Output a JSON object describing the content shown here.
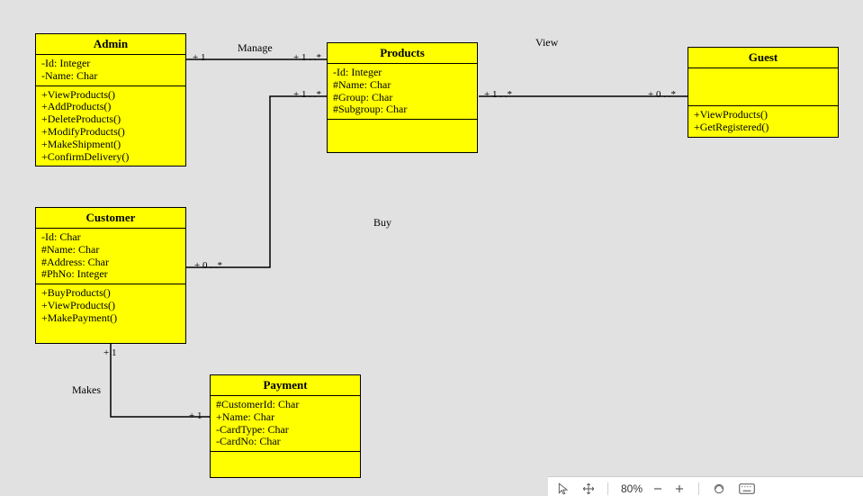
{
  "classes": {
    "admin": {
      "title": "Admin",
      "attrs": [
        "-Id: Integer",
        "-Name: Char"
      ],
      "ops": [
        "+ViewProducts()",
        "+AddProducts()",
        "+DeleteProducts()",
        "+ModifyProducts()",
        "+MakeShipment()",
        "+ConfirmDelivery()"
      ]
    },
    "products": {
      "title": "Products",
      "attrs": [
        "-Id: Integer",
        "#Name: Char",
        "#Group: Char",
        "#Subgroup: Char"
      ],
      "ops": []
    },
    "guest": {
      "title": "Guest",
      "attrs": [],
      "ops": [
        "+ViewProducts()",
        "+GetRegistered()"
      ]
    },
    "customer": {
      "title": "Customer",
      "attrs": [
        "-Id: Char",
        "#Name: Char",
        "#Address: Char",
        "#PhNo: Integer"
      ],
      "ops": [
        "+BuyProducts()",
        "+ViewProducts()",
        "+MakePayment()"
      ]
    },
    "payment": {
      "title": "Payment",
      "attrs": [
        "#CustomerId: Char",
        "+Name: Char",
        "-CardType: Char",
        "-CardNo: Char"
      ],
      "ops": []
    }
  },
  "relations": {
    "manage": {
      "label": "Manage",
      "left": "+ 1",
      "right": "+ 1 . .*"
    },
    "view": {
      "label": "View",
      "left": "+ 1 . .*",
      "right": "+ 0 . .*"
    },
    "buy": {
      "label": "Buy",
      "left": "+ 1 . .*",
      "right": "+ 0 . .*"
    },
    "makes": {
      "label": "Makes",
      "top": "+ 1",
      "right": "+ 1"
    }
  },
  "toolbar": {
    "zoom": "80%"
  }
}
